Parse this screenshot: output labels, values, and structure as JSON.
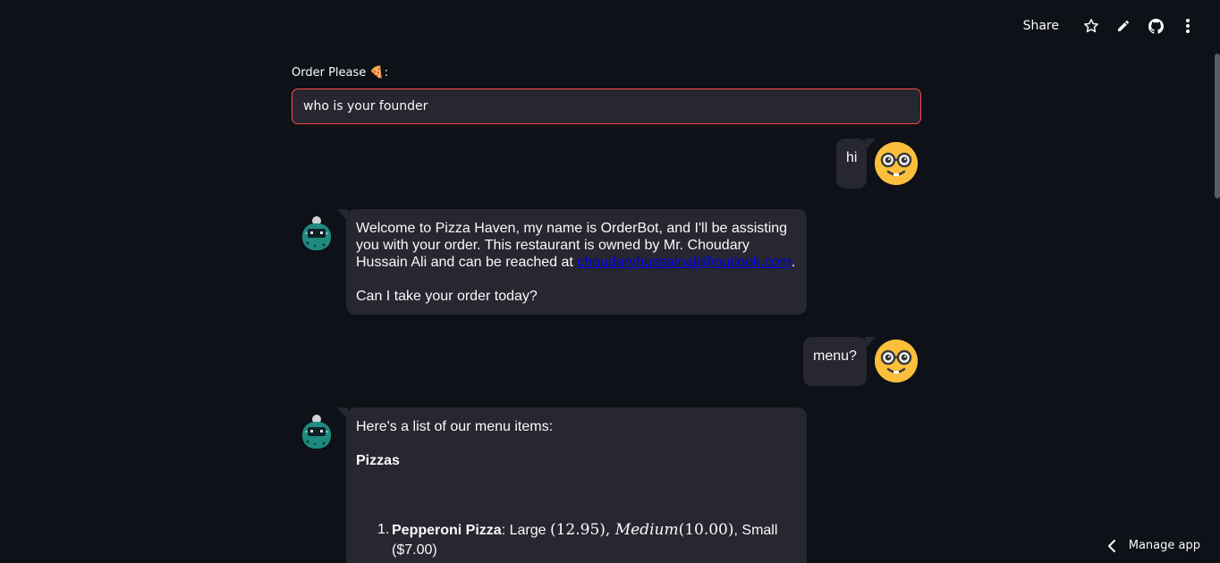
{
  "toolbar": {
    "share_label": "Share",
    "icons": [
      "star-icon",
      "pencil-icon",
      "github-icon",
      "kebab-menu-icon"
    ]
  },
  "input": {
    "label": "Order Please 🍕:",
    "value": "who is your founder"
  },
  "messages": [
    {
      "role": "user",
      "text": "hi"
    },
    {
      "role": "bot",
      "line1": "Welcome to Pizza Haven, my name is OrderBot, and I'll be assisting you with your order. This restaurant is owned by Mr. Choudary Hussain Ali and can be reached at ",
      "email": "choudaryhussainali@outlook.com",
      "line1_end": ".",
      "line2": "Can I take your order today?"
    },
    {
      "role": "user",
      "text": "menu?"
    },
    {
      "role": "bot",
      "intro": "Here's a list of our menu items:",
      "heading": "Pizzas",
      "items": [
        {
          "num": "1.",
          "name": "Pepperoni Pizza",
          "sep": ": Large ",
          "math1": "(12.95), ",
          "math_it": "Medium",
          "math2": "(10.00)",
          "rest": ", Small ($7.00)"
        }
      ]
    }
  ],
  "colors": {
    "background": "#0e1117",
    "bubble": "#262730",
    "input_border": "#ff4b4b",
    "user_avatar": "#fbbf3c",
    "link": "#0000ee"
  },
  "footer": {
    "manage_label": "Manage app"
  }
}
